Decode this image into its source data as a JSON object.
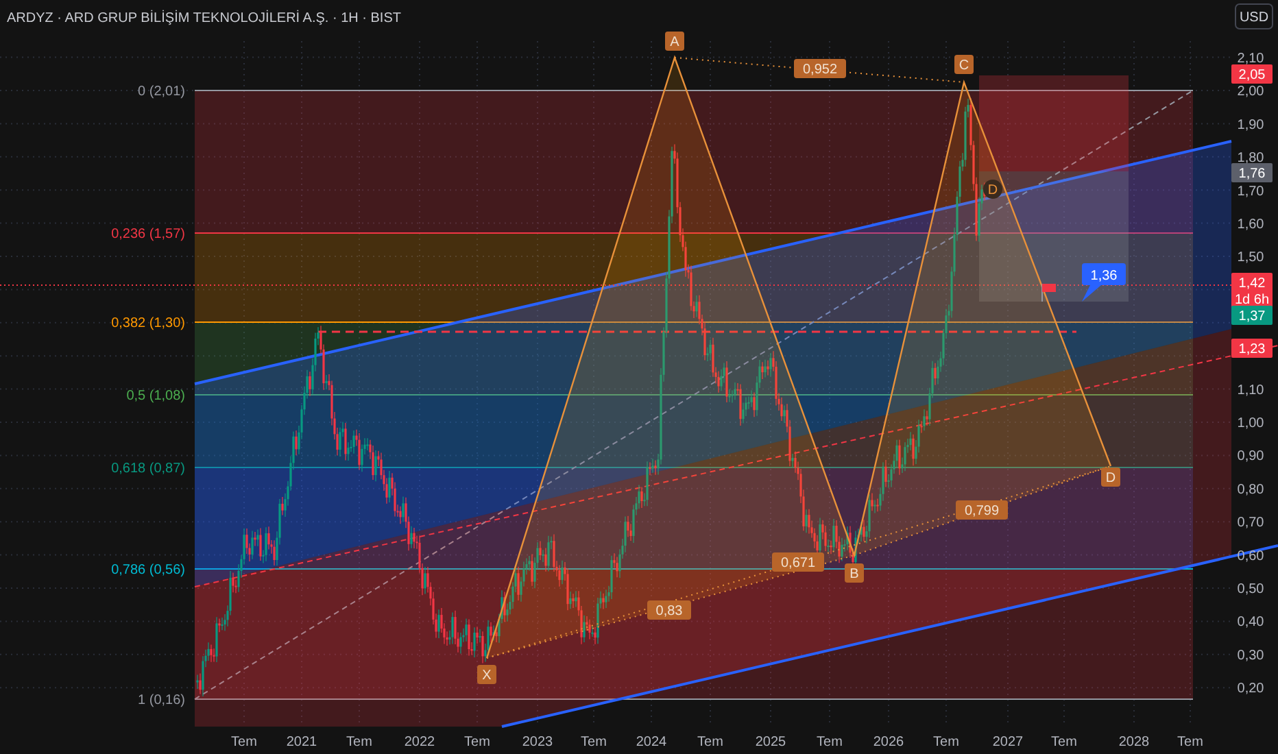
{
  "header": {
    "title": "ARDYZ · ARD GRUP BİLİŞİM TEKNOLOJİLERİ A.Ş. · 1H · BIST",
    "currency_button": "USD"
  },
  "fib_levels": [
    {
      "label": "0 (2,01)",
      "color": "#9598a1"
    },
    {
      "label": "0,236 (1,57)",
      "color": "#f23645"
    },
    {
      "label": "0,382 (1,30)",
      "color": "#ff9800"
    },
    {
      "label": "0,5 (1,08)",
      "color": "#4caf50"
    },
    {
      "label": "0,618 (0,87)",
      "color": "#089981"
    },
    {
      "label": "0,786 (0,56)",
      "color": "#00bcd4"
    },
    {
      "label": "1 (0,16)",
      "color": "#9598a1"
    }
  ],
  "pattern_points": [
    "X",
    "A",
    "B",
    "C",
    "D"
  ],
  "projection_point": "D",
  "ratios": [
    "0,952",
    "0,671",
    "0,83",
    "0,799"
  ],
  "target_callout": "1,36",
  "price_axis": {
    "ticks_upper": [
      "2,10",
      "2,00",
      "1,90",
      "1,80",
      "1,70",
      "1,60",
      "1,50"
    ],
    "ticks_lower": [
      "1,10",
      "1,00",
      "0,90",
      "0,80",
      "0,70",
      "0,60",
      "0,50",
      "0,40",
      "0,30",
      "0,20"
    ]
  },
  "price_badges": [
    {
      "value": "2,05",
      "color": "#f23645"
    },
    {
      "value": "1,76",
      "color": "#5d606b"
    },
    {
      "value": "1,42",
      "countdown": "1d 6h",
      "color": "#f23645"
    },
    {
      "value": "1,37",
      "color": "#089981"
    },
    {
      "value": "1,23",
      "color": "#f23645"
    }
  ],
  "time_axis": [
    "Tem",
    "2021",
    "Tem",
    "2022",
    "Tem",
    "2023",
    "Tem",
    "2024",
    "Tem",
    "2025",
    "Tem",
    "2026",
    "Tem",
    "2027",
    "Tem",
    "2028",
    "Tem"
  ]
}
